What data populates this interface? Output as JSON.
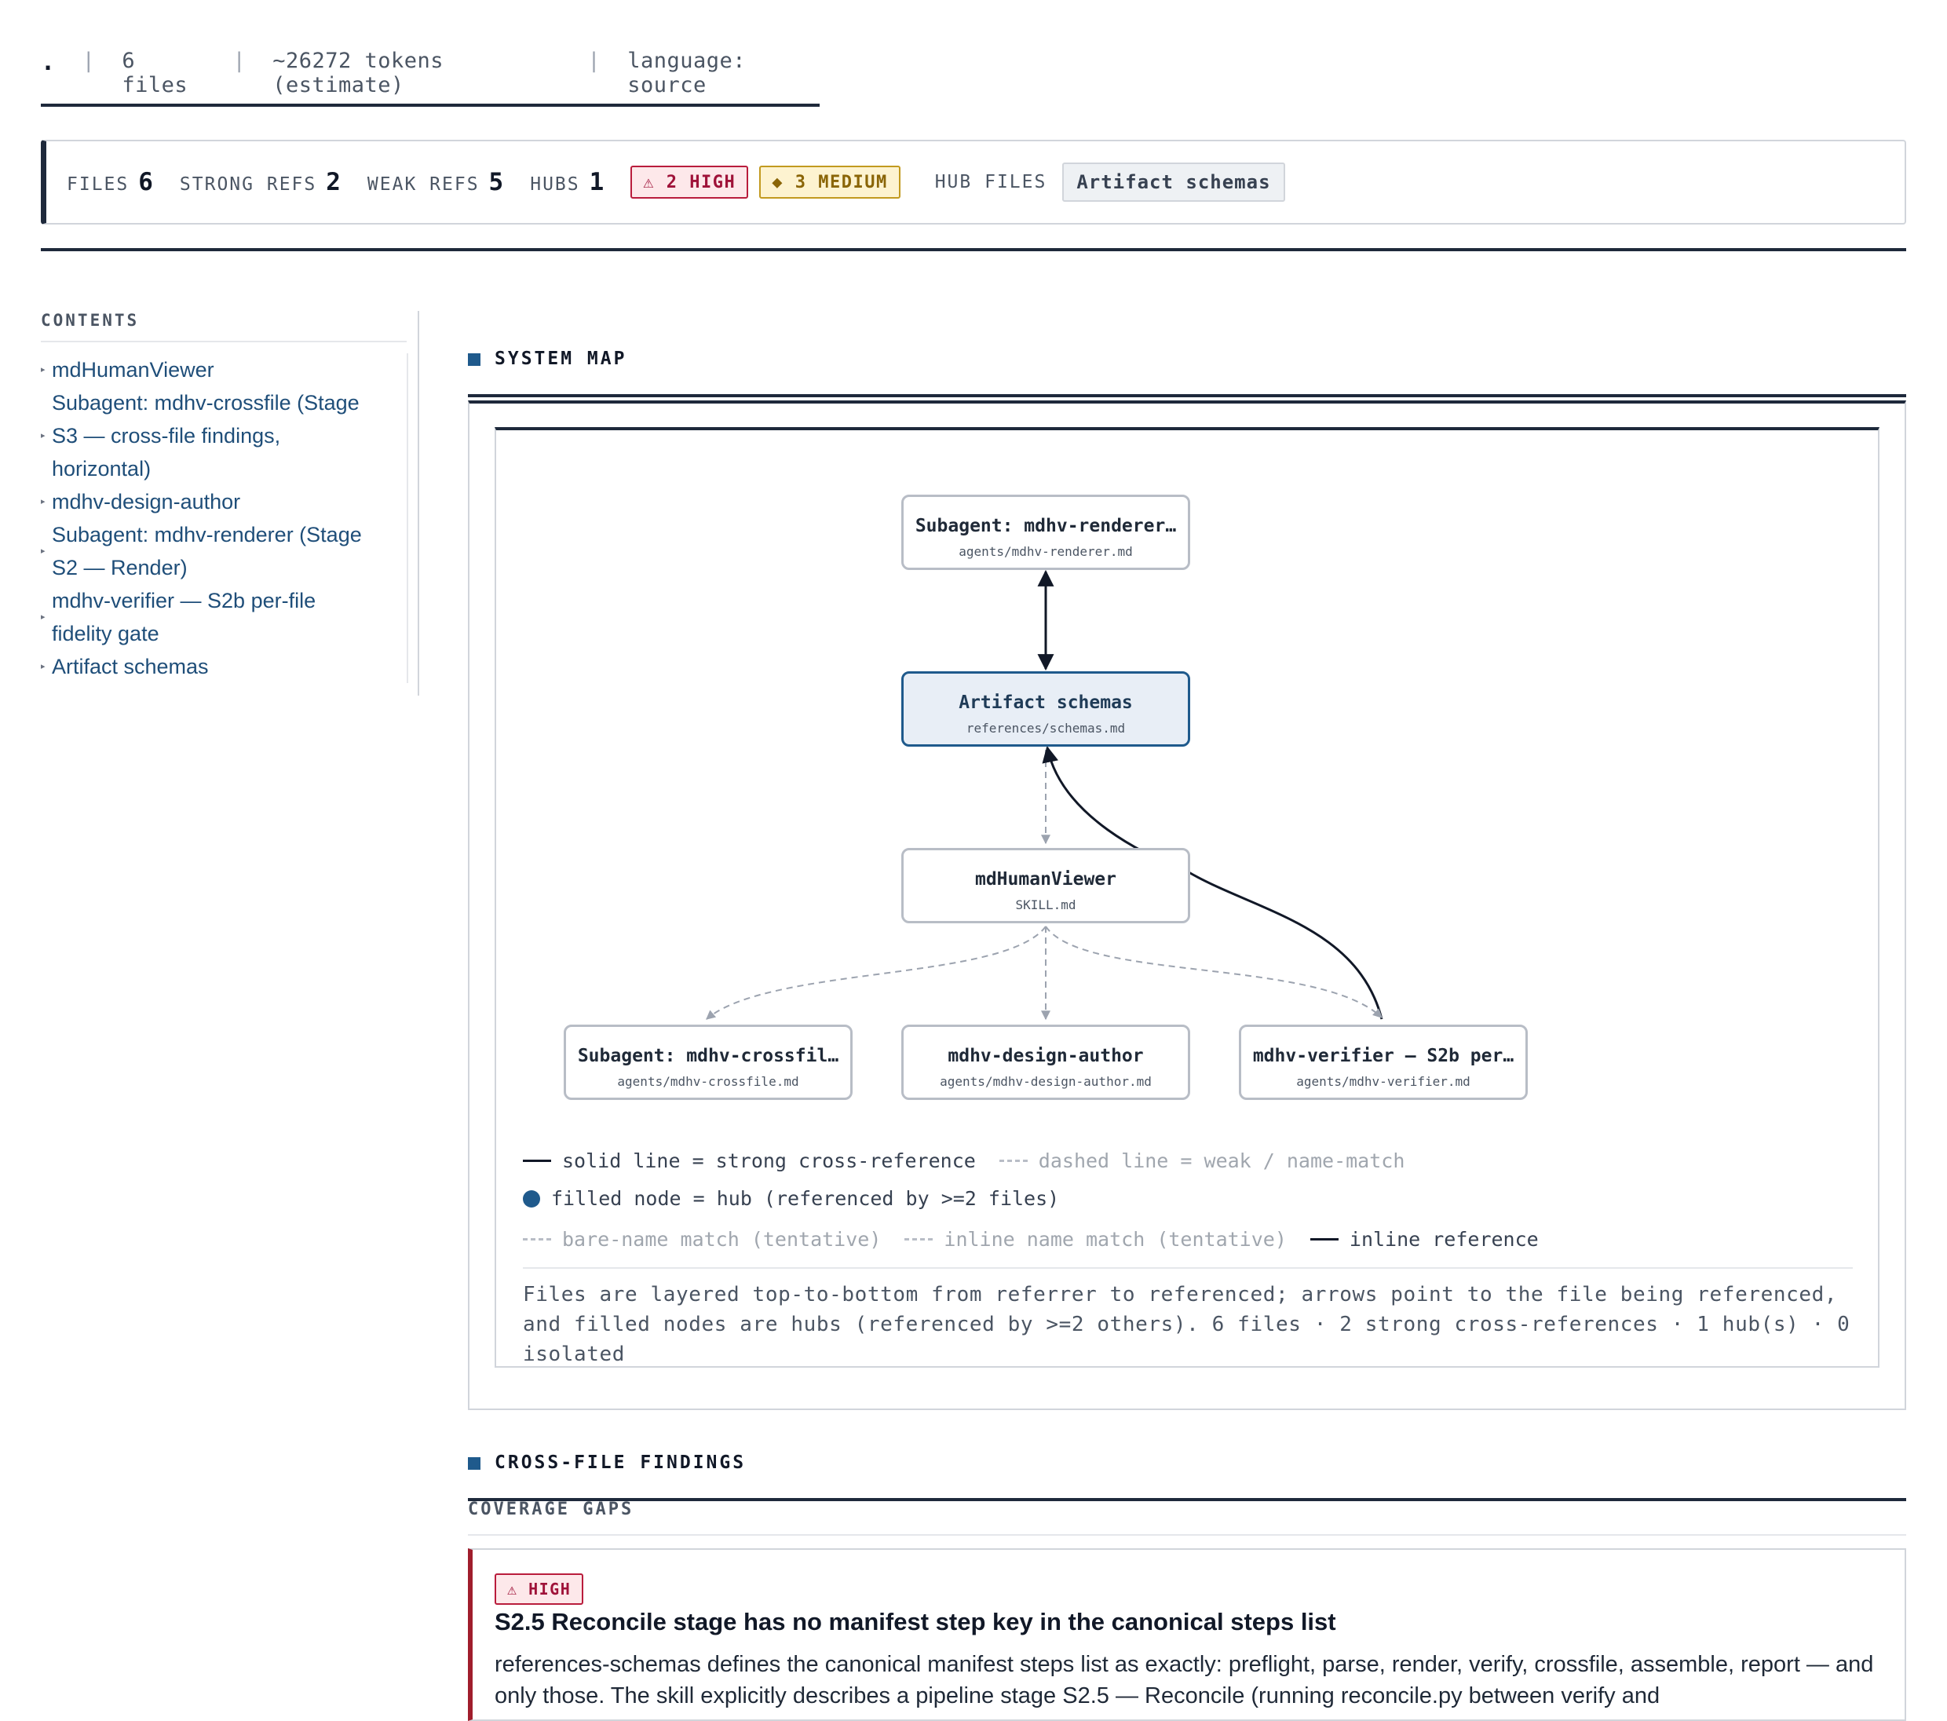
{
  "meta": {
    "root": ".",
    "files": "6 files",
    "tokens": "~26272 tokens (estimate)",
    "language": "language: source"
  },
  "stats": {
    "files_label": "FILES",
    "files_value": "6",
    "strong_label": "STRONG REFS",
    "strong_value": "2",
    "weak_label": "WEAK REFS",
    "weak_value": "5",
    "hubs_label": "HUBS",
    "hubs_value": "1",
    "high_badge": "⚠ 2 HIGH",
    "medium_badge": "◆ 3 MEDIUM",
    "hub_files_label": "HUB FILES",
    "hub_files": [
      "Artifact schemas"
    ]
  },
  "sidebar": {
    "title": "CONTENTS",
    "items": [
      {
        "label": "mdHumanViewer"
      },
      {
        "label": "Subagent: mdhv-crossfile (Stage S3 — cross-file findings, horizontal)"
      },
      {
        "label": "mdhv-design-author"
      },
      {
        "label": "Subagent: mdhv-renderer (Stage S2 — Render)"
      },
      {
        "label": "mdhv-verifier — S2b per-file fidelity gate"
      },
      {
        "label": "Artifact schemas"
      }
    ]
  },
  "system_map": {
    "title": "SYSTEM MAP",
    "nodes": {
      "renderer": {
        "title": "Subagent: mdhv-renderer…",
        "path": "agents/mdhv-renderer.md"
      },
      "schemas": {
        "title": "Artifact schemas",
        "path": "references/schemas.md"
      },
      "skill": {
        "title": "mdHumanViewer",
        "path": "SKILL.md"
      },
      "crossfile": {
        "title": "Subagent: mdhv-crossfil…",
        "path": "agents/mdhv-crossfile.md"
      },
      "design": {
        "title": "mdhv-design-author",
        "path": "agents/mdhv-design-author.md"
      },
      "verifier": {
        "title": "mdhv-verifier — S2b per…",
        "path": "agents/mdhv-verifier.md"
      }
    },
    "legend": {
      "solid": "solid line = strong cross-reference",
      "dashed": "dashed line = weak / name-match",
      "hub": "filled node = hub (referenced by >=2 files)",
      "bare": "bare-name match (tentative)",
      "inline_name": "inline name match (tentative)",
      "inline_ref": "inline reference"
    },
    "caption": "Files are layered top-to-bottom from referrer to referenced; arrows point to the file being referenced, and filled nodes are hubs (referenced by >=2 others). 6 files · 2 strong cross-references · 1 hub(s) · 0 isolated",
    "colors": {
      "hub": "#1f5a8c",
      "hub_fill": "#e8eef6",
      "strong": "#111827",
      "weak": "#a0a6ae"
    }
  },
  "findings": {
    "title": "CROSS-FILE FINDINGS",
    "group": "COVERAGE GAPS",
    "items": [
      {
        "severity": "⚠ HIGH",
        "title": "S2.5 Reconcile stage has no manifest step key in the canonical steps list",
        "body": "references-schemas defines the canonical manifest steps list as exactly: preflight, parse, render, verify, crossfile, assemble, report — and only those. The skill explicitly describes a pipeline stage S2.5 — Reconcile (running reconcile.py between verify and"
      }
    ]
  }
}
